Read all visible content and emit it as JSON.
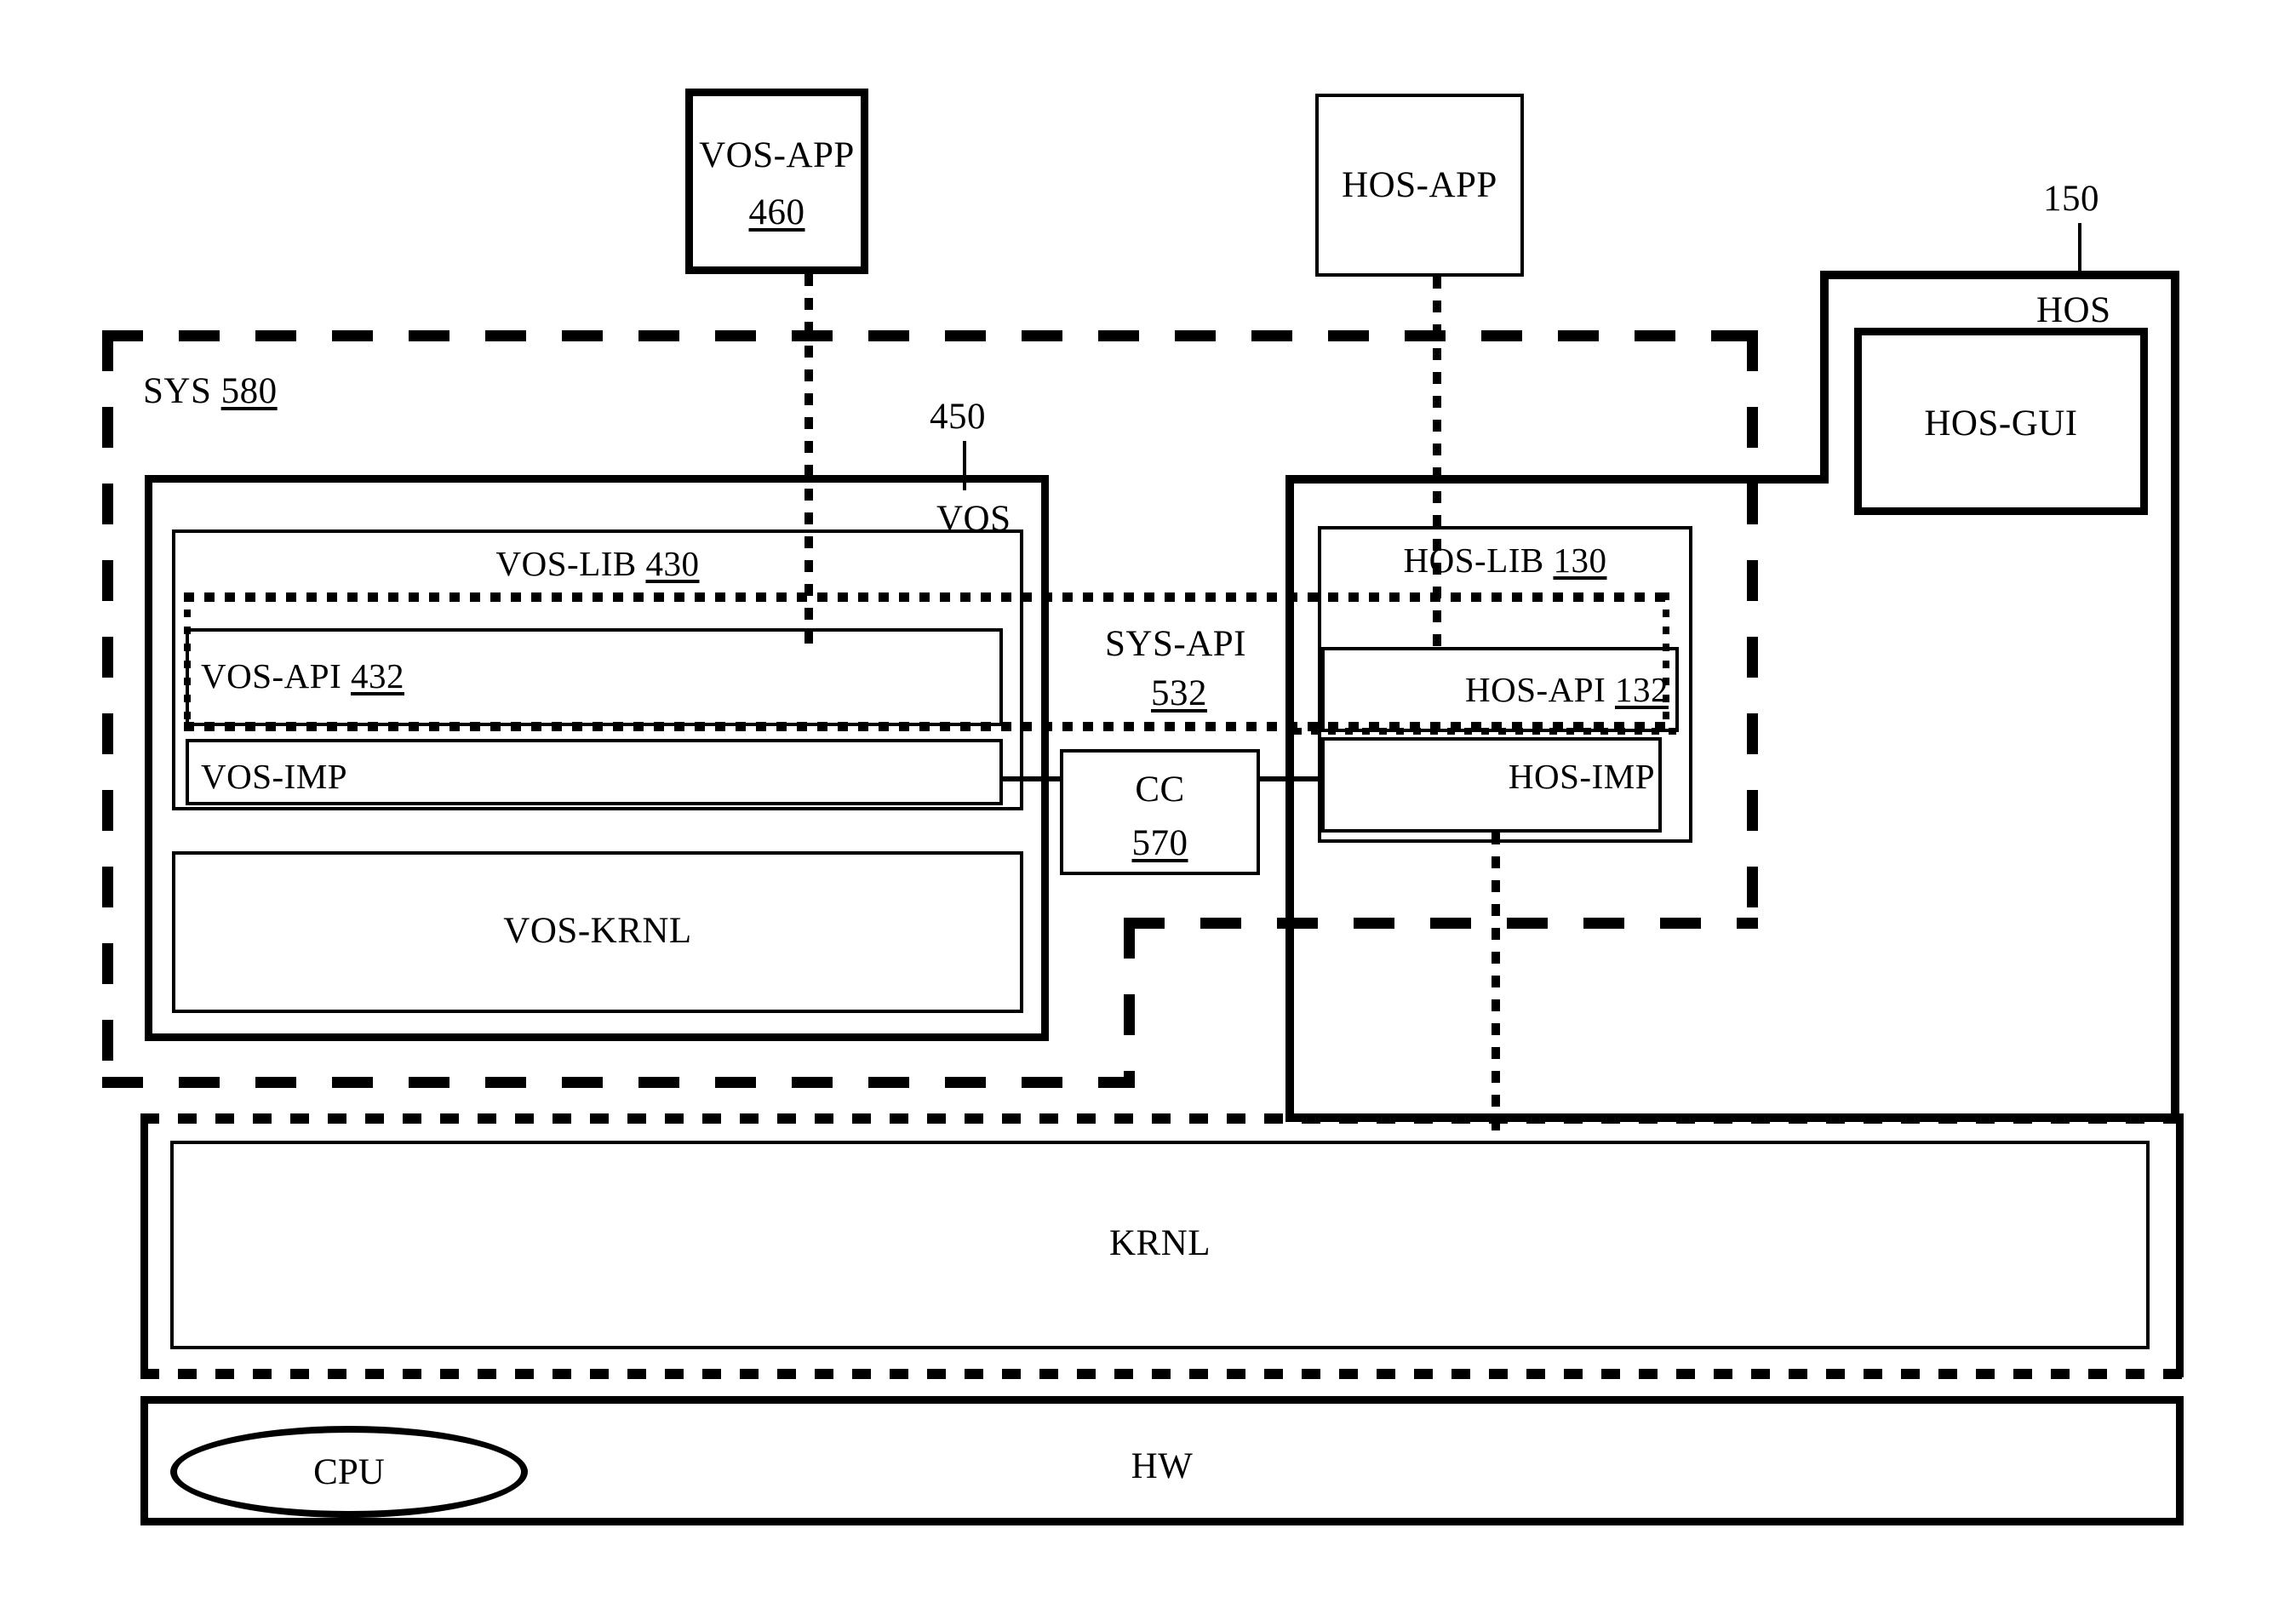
{
  "figure": {
    "title": "Operating system layering block diagram",
    "type": "block-diagram"
  },
  "nodes": {
    "vos_app": {
      "label": "VOS-APP",
      "ref": "460"
    },
    "hos_app": {
      "label": "HOS-APP",
      "ref": ""
    },
    "sys": {
      "label": "SYS",
      "ref": "580"
    },
    "vos": {
      "label": "VOS",
      "ref": "450"
    },
    "vos_lib": {
      "label": "VOS-LIB",
      "ref": "430"
    },
    "vos_api": {
      "label": "VOS-API",
      "ref": "432"
    },
    "vos_imp": {
      "label": "VOS-IMP",
      "ref": ""
    },
    "vos_krnl": {
      "label": "VOS-KRNL",
      "ref": ""
    },
    "sys_api": {
      "label": "SYS-API",
      "ref": "532"
    },
    "cc": {
      "label": "CC",
      "ref": "570"
    },
    "hos": {
      "label": "HOS",
      "ref": "150"
    },
    "hos_gui": {
      "label": "HOS-GUI",
      "ref": ""
    },
    "hos_lib": {
      "label": "HOS-LIB",
      "ref": "130"
    },
    "hos_api": {
      "label": "HOS-API",
      "ref": "132"
    },
    "hos_imp": {
      "label": "HOS-IMP",
      "ref": ""
    },
    "krnl": {
      "label": "KRNL",
      "ref": ""
    },
    "hw": {
      "label": "HW",
      "ref": ""
    },
    "cpu": {
      "label": "CPU",
      "ref": ""
    }
  },
  "colors": {
    "stroke": "#000000",
    "background": "#ffffff"
  }
}
